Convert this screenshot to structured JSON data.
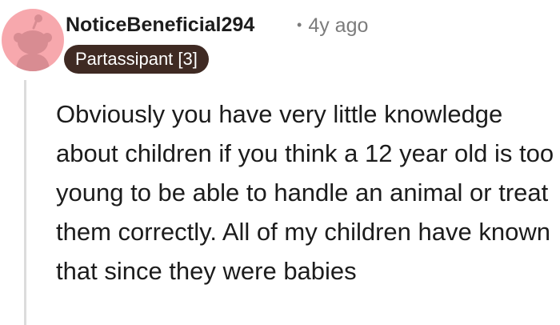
{
  "comment": {
    "author": "NoticeBeneficial294",
    "separator": "•",
    "age": "4y ago",
    "flair": "Partassipant [3]",
    "body": "Obviously you have very little knowledge about children if you think a 12 year old is too young to be able to handle an animal or treat them correctly. All of my children have known that since they were babies"
  },
  "colors": {
    "avatar_bg": "#f7a8ad",
    "avatar_snoo": "#d88c92",
    "flair_bg": "#3f2a23",
    "username": "#1c1c1c",
    "meta": "#7c7c7c",
    "thread_line": "#dcdcdc"
  },
  "icons": {
    "avatar": "snoo-avatar-icon"
  }
}
